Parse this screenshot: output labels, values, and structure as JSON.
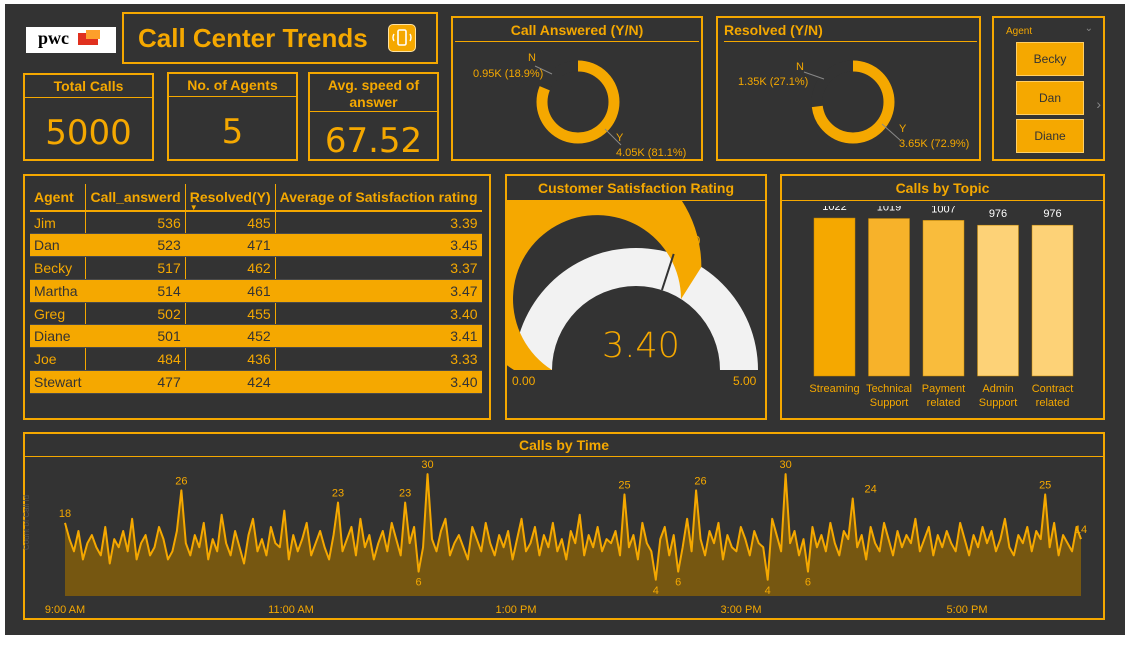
{
  "header": {
    "logo_text": "pwc",
    "title": "Call Center Trends",
    "icon": "phone-icon"
  },
  "cards": {
    "total_calls": {
      "label": "Total Calls",
      "value": "5000"
    },
    "agents": {
      "label": "No. of Agents",
      "value": "5"
    },
    "speed": {
      "label": "Avg. speed of answer",
      "value": "67.52"
    }
  },
  "call_answered": {
    "title": "Call Answered (Y/N)",
    "n_key": "N",
    "n_label": "0.95K (18.9%)",
    "y_key": "Y",
    "y_label": "4.05K (81.1%)",
    "y_fraction": 0.811
  },
  "resolved": {
    "title": "Resolved (Y/N)",
    "n_key": "N",
    "n_label": "1.35K (27.1%)",
    "y_key": "Y",
    "y_label": "3.65K (72.9%)",
    "y_fraction": 0.729
  },
  "slicer": {
    "title": "Agent",
    "items": [
      "Becky",
      "Dan",
      "Diane"
    ]
  },
  "table": {
    "headers": [
      "Agent",
      "Call_answerd",
      "Resolved(Y)",
      "Average of Satisfaction rating"
    ],
    "rows": [
      [
        "Jim",
        "536",
        "485",
        "3.39"
      ],
      [
        "Dan",
        "523",
        "471",
        "3.45"
      ],
      [
        "Becky",
        "517",
        "462",
        "3.37"
      ],
      [
        "Martha",
        "514",
        "461",
        "3.47"
      ],
      [
        "Greg",
        "502",
        "455",
        "3.40"
      ],
      [
        "Diane",
        "501",
        "452",
        "3.41"
      ],
      [
        "Joe",
        "484",
        "436",
        "3.33"
      ],
      [
        "Stewart",
        "477",
        "424",
        "3.40"
      ]
    ]
  },
  "gauge": {
    "title": "Customer Satisfaction Rating",
    "value": "3.40",
    "target": "3.00",
    "min": "0.00",
    "max": "5.00",
    "value_num": 3.4,
    "target_num": 3.0,
    "min_num": 0,
    "max_num": 5
  },
  "topics": {
    "title": "Calls by Topic",
    "chart_data": {
      "type": "bar",
      "categories": [
        "Streaming",
        "Technical Support",
        "Payment related",
        "Admin Support",
        "Contract related"
      ],
      "category_lines": [
        [
          "Streaming"
        ],
        [
          "Technical",
          "Support"
        ],
        [
          "Payment",
          "related"
        ],
        [
          "Admin",
          "Support"
        ],
        [
          "Contract",
          "related"
        ]
      ],
      "values": [
        1022,
        1019,
        1007,
        976,
        976
      ],
      "colors": [
        "#f5a800",
        "#f7b22a",
        "#f9bc3c",
        "#fdd277",
        "#fdd277"
      ],
      "ylim": [
        0,
        1100
      ]
    }
  },
  "time": {
    "title": "Calls by Time",
    "ylabel": "Count of Call Id",
    "chart_data": {
      "type": "area",
      "x_ticks": [
        "9:00 AM",
        "11:00 AM",
        "1:00 PM",
        "3:00 PM",
        "5:00 PM"
      ],
      "labels": [
        {
          "i": 0,
          "v": 18
        },
        {
          "i": 26,
          "v": 26
        },
        {
          "i": 61,
          "v": 23
        },
        {
          "i": 76,
          "v": 23
        },
        {
          "i": 81,
          "v": 30
        },
        {
          "i": 79,
          "v": 6
        },
        {
          "i": 132,
          "v": 4
        },
        {
          "i": 137,
          "v": 6
        },
        {
          "i": 125,
          "v": 25
        },
        {
          "i": 142,
          "v": 26
        },
        {
          "i": 161,
          "v": 30
        },
        {
          "i": 157,
          "v": 4
        },
        {
          "i": 166,
          "v": 6
        },
        {
          "i": 180,
          "v": 24
        },
        {
          "i": 219,
          "v": 25
        },
        {
          "i": 227,
          "v": 14
        }
      ],
      "ylim": [
        0,
        32
      ],
      "values": [
        18,
        14,
        11,
        16,
        9,
        13,
        15,
        12,
        10,
        17,
        8,
        14,
        12,
        16,
        11,
        19,
        9,
        13,
        15,
        10,
        12,
        17,
        14,
        9,
        11,
        16,
        26,
        13,
        10,
        15,
        12,
        18,
        9,
        14,
        11,
        20,
        13,
        10,
        16,
        12,
        8,
        15,
        19,
        11,
        14,
        10,
        17,
        13,
        12,
        21,
        9,
        15,
        11,
        14,
        18,
        10,
        13,
        16,
        12,
        9,
        15,
        23,
        11,
        14,
        17,
        10,
        19,
        12,
        15,
        9,
        13,
        16,
        11,
        18,
        14,
        10,
        23,
        13,
        17,
        6,
        12,
        30,
        14,
        11,
        16,
        19,
        10,
        13,
        15,
        12,
        9,
        17,
        14,
        11,
        18,
        13,
        10,
        15,
        12,
        16,
        9,
        14,
        19,
        11,
        13,
        17,
        10,
        15,
        12,
        18,
        11,
        14,
        9,
        16,
        13,
        20,
        10,
        15,
        12,
        17,
        11,
        14,
        13,
        16,
        10,
        25,
        12,
        15,
        9,
        18,
        13,
        11,
        4,
        14,
        17,
        10,
        15,
        6,
        12,
        19,
        11,
        26,
        14,
        10,
        16,
        13,
        18,
        9,
        15,
        12,
        11,
        17,
        14,
        10,
        16,
        13,
        12,
        4,
        19,
        15,
        11,
        30,
        13,
        16,
        10,
        14,
        6,
        17,
        12,
        15,
        11,
        18,
        13,
        10,
        16,
        14,
        24,
        12,
        15,
        9,
        17,
        13,
        11,
        18,
        14,
        10,
        16,
        12,
        15,
        13,
        19,
        11,
        14,
        17,
        10,
        15,
        12,
        16,
        13,
        11,
        18,
        14,
        10,
        15,
        12,
        17,
        13,
        16,
        11,
        14,
        19,
        12,
        10,
        15,
        13,
        17,
        11,
        16,
        14,
        25,
        12,
        18,
        10,
        15,
        13,
        11,
        17,
        14
      ],
      "y_axis_title": "Count of Call Id"
    }
  }
}
